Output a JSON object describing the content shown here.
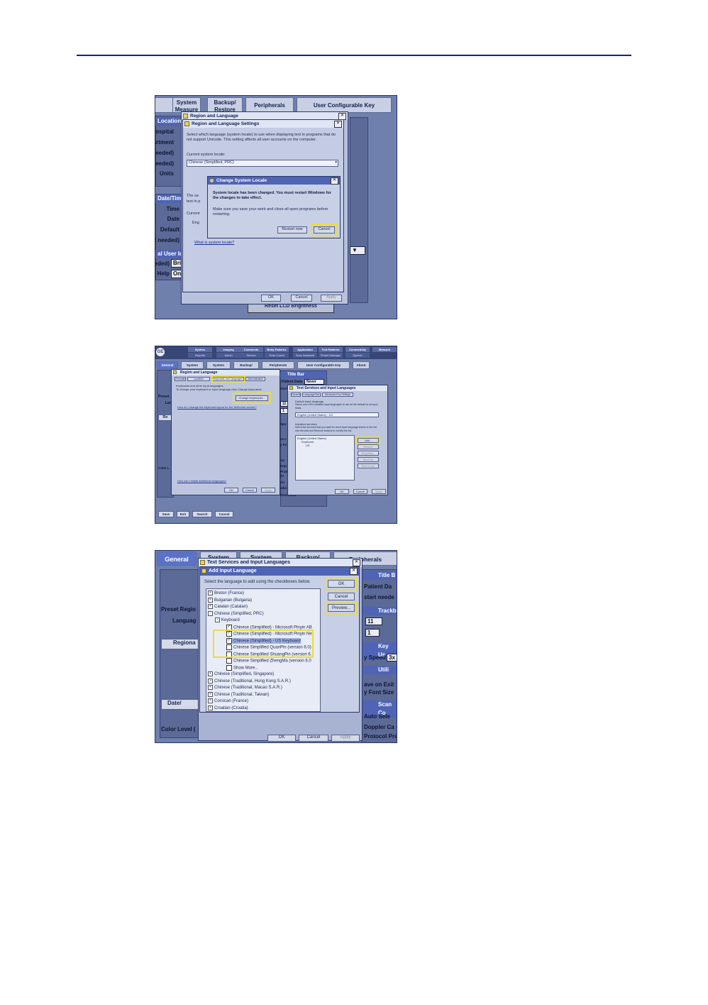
{
  "colors": {
    "rule": "#1a1aa0",
    "highlight": "#ecdc3a",
    "panel": "#5c6a97",
    "header": "#4f64b5"
  },
  "shot1": {
    "tabs": [
      "System Measure",
      "Backup/ Restore",
      "Peripherals",
      "User Configurable Key"
    ],
    "left_labels": [
      "Location",
      "Hospital",
      "artment",
      "eeded)",
      "eeded)",
      "Units",
      "Date/Time",
      "Time",
      "Date",
      "Default",
      "rt needed)",
      "al User In",
      "eeded)",
      "Help"
    ],
    "left_values": [
      "Bri",
      "On"
    ],
    "region_window": {
      "title": "Region and Language",
      "ok": "OK",
      "cancel": "Cancel",
      "apply": "Apply"
    },
    "settings_dialog": {
      "title": "Region and Language Settings",
      "desc": "Select which language (system locale) to use when displaying text in programs that do not support Unicode. This setting affects all user accounts on the computer.",
      "current_label": "Current system locale:",
      "current_value": "Chinese (Simplified, PRC)",
      "link": "What is system locale?",
      "frag_text": "text in p",
      "frag_current": "Current",
      "frag_eng": "Eng",
      "frag_the": "The sa"
    },
    "change_dialog": {
      "title": "Change System Locale",
      "message": "System locale has been changed. You must restart Windows for the changes to take effect.",
      "note": "Make sure you save your work and close all open programs before restarting.",
      "restart": "Restart now",
      "cancel": "Cancel"
    },
    "bottom_text": "Reset LCD Brightness"
  },
  "shot2": {
    "brand": "GE",
    "top_tabs_row1": [
      "System",
      "Imaging",
      "Comments",
      "Body Patterns",
      "Application",
      "Text Patterns",
      "Connectivity",
      "Measure"
    ],
    "top_tabs_row2": [
      "Reports",
      "Admin",
      "Service",
      "Scan Coach",
      "Scan Assistant",
      "Preset Manager",
      "Speech"
    ],
    "sub_tabs": [
      "General",
      "System",
      "System",
      "Backup/ Restore",
      "Peripherals",
      "User Configurable Key",
      "About"
    ],
    "left_labels": [
      "Preset",
      "Lan",
      "Re",
      "Color L"
    ],
    "title_bar": "Title Bar",
    "patient_data": "Patient Data",
    "patient_value": "Never",
    "region": {
      "title": "Region and Language",
      "tabs": [
        "Formats",
        "Location",
        "Keyboards and Languages",
        "Administrative"
      ],
      "section": "Keyboards and other input languages",
      "desc": "To change your keyboard or input language click Change keyboards.",
      "button": "Change keyboards...",
      "link1": "How do I change the keyboard layout for the Welcome screen?",
      "link2": "How can I install additional languages?",
      "ok": "OK",
      "cancel": "Cancel",
      "apply": "Apply"
    },
    "text_services": {
      "title": "Text Services and Input Languages",
      "tabs": [
        "General",
        "Language Bar",
        "Advanced Key Settings"
      ],
      "default_label": "Default input language",
      "default_desc": "Select one of the installed input languages to use as the default for all input fields.",
      "default_value": "English (United States) - US",
      "installed_label": "Installed services",
      "installed_desc": "Select the services that you want for each input language shown in the list. Use the Add and Remove buttons to modify this list.",
      "tree": [
        "English (United States)",
        "Keyboard",
        "US"
      ],
      "buttons": [
        "Add...",
        "Remove",
        "Properties...",
        "Move Up",
        "Move Down"
      ],
      "ok": "OK",
      "cancel": "Cancel",
      "apply": "Apply"
    },
    "bottom_buttons": [
      "Save",
      "Exit",
      "Search",
      "Cancel"
    ],
    "frag_values": [
      "11",
      "1"
    ],
    "frag_labels": [
      "start",
      "Spe",
      "ve c",
      "y Fo",
      "Au",
      "Dop",
      "Proto",
      "ile",
      "Au",
      "adio",
      "Reset LCD"
    ]
  },
  "shot3": {
    "tabs": [
      "General",
      "System",
      "System",
      "Backup/",
      "Peripherals"
    ],
    "left_labels": [
      "Preset Regio",
      "Languag",
      "Regiona",
      "Date/",
      "Color Level ("
    ],
    "right_headers": [
      "Title B",
      "Trackb",
      "Key Us",
      "Utili",
      "Scan Co"
    ],
    "right_labels": [
      "Patient Da",
      "start neede",
      "y Speed",
      "ave on Exit",
      "y Font Size",
      "Auto Sele",
      "Doppler Ca",
      "Protocol Pre"
    ],
    "right_values": [
      "11",
      "1",
      "3x"
    ],
    "text_services_title": "Text Services and Input Languages",
    "add_dialog": {
      "title": "Add Input Language",
      "desc": "Select the language to add using the checkboxes below.",
      "ok": "OK",
      "cancel": "Cancel",
      "preview": "Preview...",
      "items": [
        "Breton (France)",
        "Bulgarian (Bulgaria)",
        "Catalan (Catalan)",
        "Chinese (Simplified, PRC)",
        "Keyboard",
        "Chinese (Simplified) - Microsoft Pinyin AB",
        "Chinese (Simplified) - Microsoft Pinyin Ne",
        "Chinese (Simplified) - US Keyboard",
        "Chinese Simplified QuanPin (version 6.0)",
        "Chinese Simplified ShuangPin (version 6.",
        "Chinese Simplified ZhengMa (version 6.0",
        "Show More...",
        "Chinese (Simplified, Singapore)",
        "Chinese (Traditional, Hong Kong S.A.R.)",
        "Chinese (Traditional, Macao S.A.R.)",
        "Chinese (Traditional, Taiwan)",
        "Corsican (France)",
        "Croatian (Croatia)"
      ]
    },
    "bottom_buttons": [
      "OK",
      "Cancel",
      "Apply"
    ]
  }
}
